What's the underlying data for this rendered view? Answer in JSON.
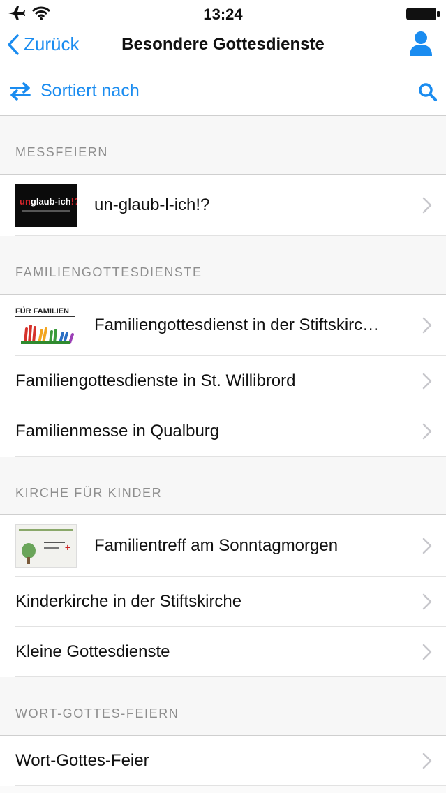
{
  "status_bar": {
    "time": "13:24"
  },
  "nav": {
    "back_label": "Zurück",
    "title": "Besondere Gottesdienste"
  },
  "toolbar": {
    "sort_label": "Sortiert nach"
  },
  "colors": {
    "accent": "#1a8cf0",
    "section_text": "#8e8e8e",
    "chevron": "#c7c7cc"
  },
  "thumbnails": {
    "glaub_logo_text": "unglaub-ich!?",
    "familien_logo_text": "FÜR FAMILIEN"
  },
  "sections": [
    {
      "header": "MESSFEIERN",
      "items": [
        {
          "label": "un-glaub-l-ich!?"
        }
      ]
    },
    {
      "header": "FAMILIENGOTTESDIENSTE",
      "items": [
        {
          "label": "Familiengottesdienst in der Stiftskirc…"
        },
        {
          "label": "Familiengottesdienste in St. Willibrord"
        },
        {
          "label": "Familienmesse in Qualburg"
        }
      ]
    },
    {
      "header": "KIRCHE FÜR KINDER",
      "items": [
        {
          "label": "Familientreff am Sonntagmorgen"
        },
        {
          "label": "Kinderkirche in der Stiftskirche"
        },
        {
          "label": "Kleine Gottesdienste"
        }
      ]
    },
    {
      "header": "WORT-GOTTES-FEIERN",
      "items": [
        {
          "label": "Wort-Gottes-Feier"
        }
      ]
    }
  ]
}
